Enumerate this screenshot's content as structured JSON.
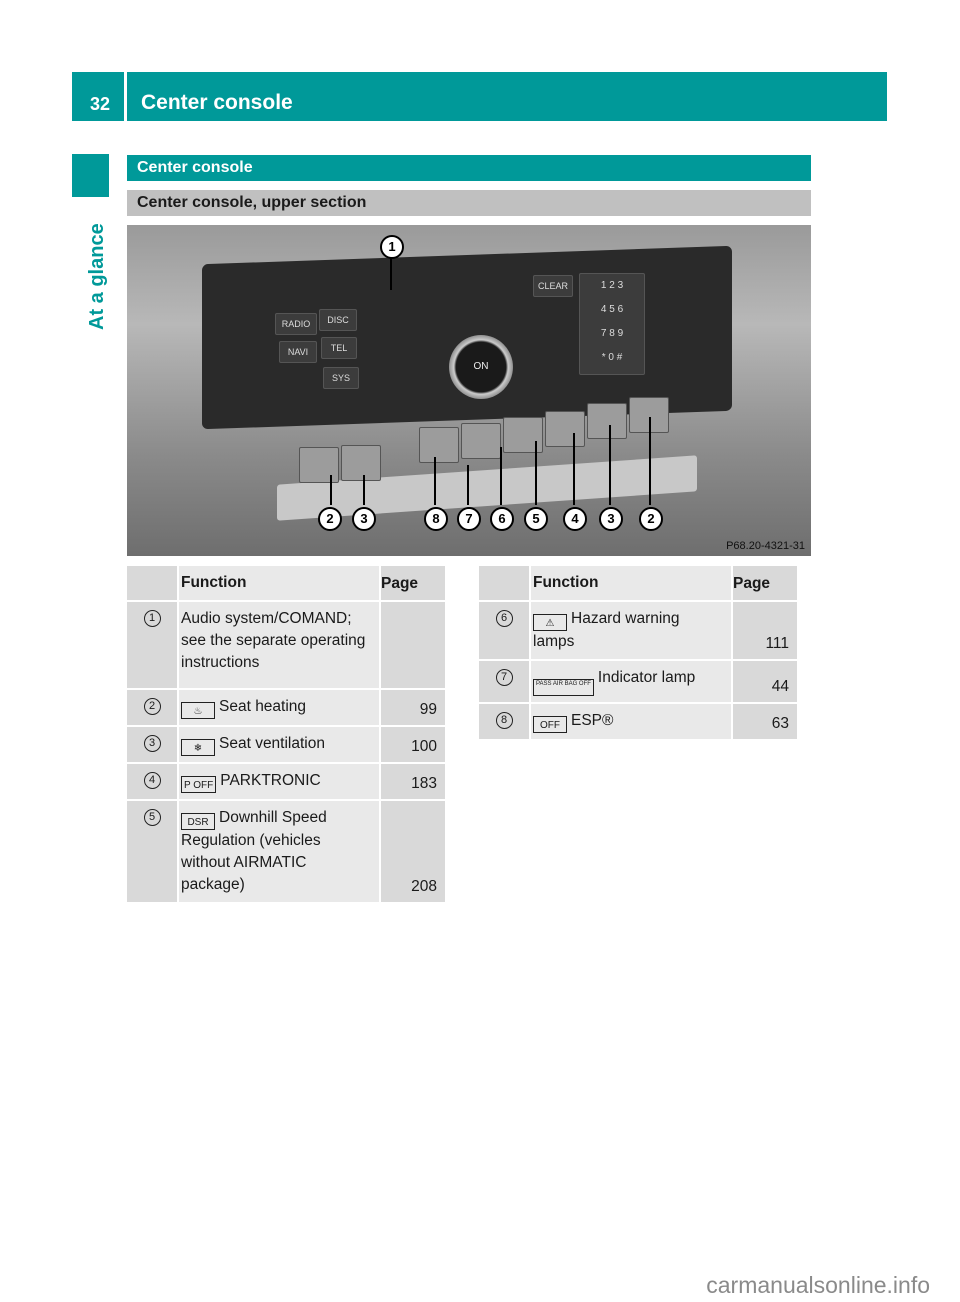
{
  "header": {
    "page_number": "32",
    "title": "Center console"
  },
  "sidebar": {
    "section_label": "At a glance"
  },
  "section": {
    "title": "Center console",
    "subtitle": "Center console, upper section"
  },
  "photo": {
    "code": "P68.20-4321-31",
    "buttons": {
      "radio": "RADIO",
      "disc": "DISC",
      "navi": "NAVI",
      "tel": "TEL",
      "sys": "SYS",
      "clear": "CLEAR",
      "on": "ON",
      "keypad": [
        "1",
        "2",
        "3",
        "4",
        "5",
        "6",
        "7",
        "8",
        "9",
        "*",
        "0",
        "#"
      ]
    },
    "callouts": [
      "1",
      "2",
      "3",
      "8",
      "7",
      "6",
      "5",
      "4",
      "3",
      "2"
    ]
  },
  "table_left": {
    "headers": {
      "function": "Function",
      "page": "Page"
    },
    "rows": [
      {
        "num": "1",
        "icon": "",
        "function": "Audio system/COMAND; see the separate operating instructions",
        "page": ""
      },
      {
        "num": "2",
        "icon": "seat-heating-icon",
        "icon_glyph": "♨",
        "function": "Seat heating",
        "page": "99"
      },
      {
        "num": "3",
        "icon": "seat-ventilation-icon",
        "icon_glyph": "❄",
        "function": "Seat ventilation",
        "page": "100"
      },
      {
        "num": "4",
        "icon": "parktronic-off-icon",
        "icon_glyph": "P OFF",
        "function": "PARKTRONIC",
        "page": "183"
      },
      {
        "num": "5",
        "icon": "dsr-icon",
        "icon_glyph": "DSR",
        "function": "Downhill Speed Regulation (vehicles without AIRMATIC package)",
        "page": "208"
      }
    ]
  },
  "table_right": {
    "headers": {
      "function": "Function",
      "page": "Page"
    },
    "rows": [
      {
        "num": "6",
        "icon": "hazard-warning-icon",
        "icon_glyph": "⚠",
        "function": "Hazard warning lamps",
        "page": "111"
      },
      {
        "num": "7",
        "icon": "pass-airbag-off-icon",
        "icon_glyph": "PASS AIR BAG OFF",
        "function": "Indicator lamp",
        "page": "44"
      },
      {
        "num": "8",
        "icon": "esp-off-icon",
        "icon_glyph": "OFF",
        "function": "ESP®",
        "page": "63"
      }
    ]
  },
  "footer": {
    "watermark": "carmanualsonline.info"
  }
}
